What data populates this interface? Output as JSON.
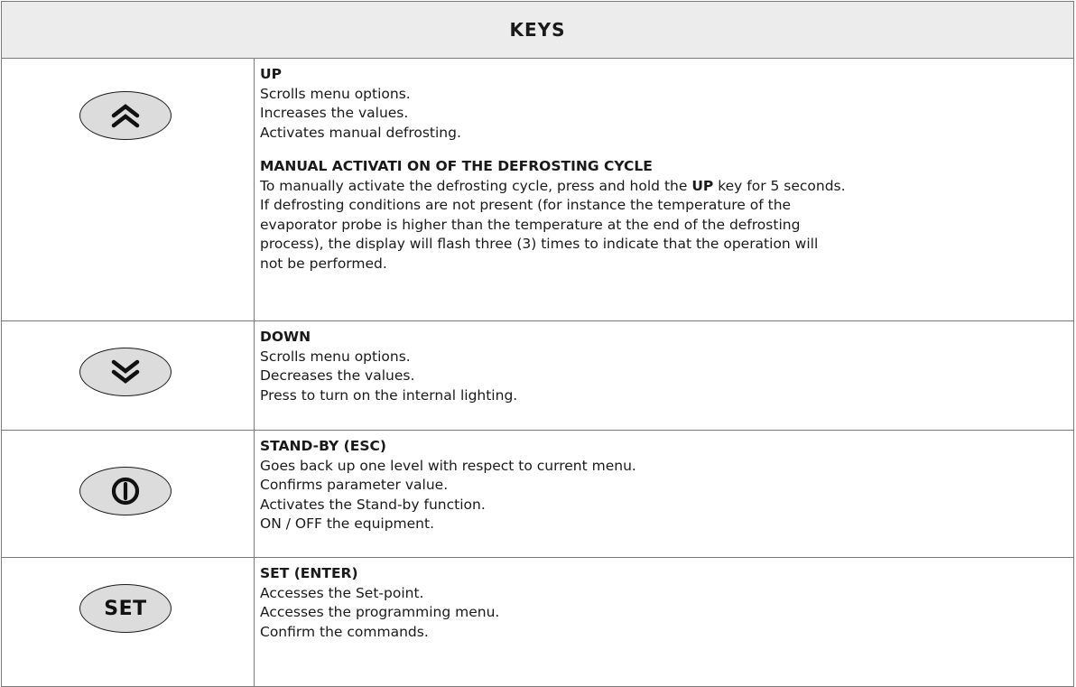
{
  "header": {
    "title": "KEYS"
  },
  "keys": [
    {
      "icon": "double-chevron-up-icon",
      "title": "UP",
      "lines": [
        "Scrolls menu options.",
        "Increases the values.",
        "Activates manual defrosting."
      ],
      "subtitle": "MANUAL ACTIVATI ON OF THE DEFROSTING CYCLE",
      "para_prefix": "To manually activate the defrosting cycle, press and hold the ",
      "para_bold": "UP",
      "para_suffix": " key for 5 seconds.",
      "para_lines": [
        "If defrosting conditions are not present (for instance the temperature of the",
        "evaporator probe is higher than the temperature at the end of the defrosting",
        "process), the display will flash three (3) times to indicate that the operation will",
        "not be performed."
      ]
    },
    {
      "icon": "double-chevron-down-icon",
      "title": "DOWN",
      "lines": [
        "Scrolls menu options.",
        "Decreases the values.",
        "Press to turn on the internal lighting."
      ]
    },
    {
      "icon": "power-icon",
      "title": "STAND-BY (ESC)",
      "lines": [
        "Goes back up one level with respect to current menu.",
        "Confirms parameter value.",
        "Activates the Stand-by function.",
        "ON / OFF the equipment."
      ]
    },
    {
      "icon": "set-label-icon",
      "button_label": "SET",
      "title": "SET (ENTER)",
      "lines": [
        "Accesses the Set-point.",
        "Accesses the programming menu.",
        "Confirm the commands."
      ]
    }
  ]
}
